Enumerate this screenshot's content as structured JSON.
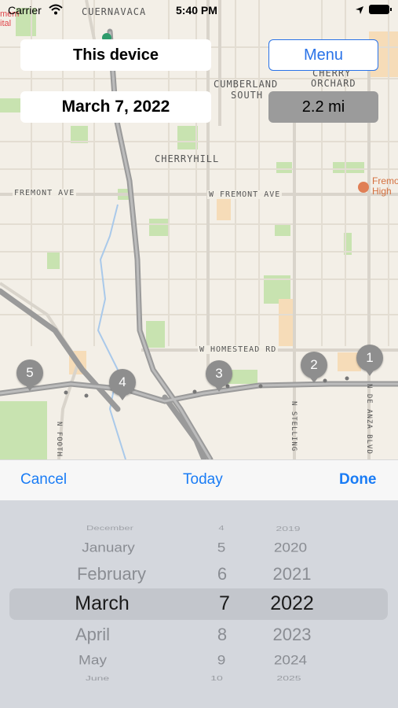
{
  "status_bar": {
    "carrier": "Carrier",
    "time": "5:40 PM"
  },
  "map": {
    "labels": {
      "cuernavaca": "CUERNAVACA",
      "cumberland_line1": "CUMBERLAND",
      "cumberland_line2": "SOUTH",
      "cherry_orchard_line1": "CHERRY",
      "cherry_orchard_line2": "ORCHARD",
      "cherryhill": "CHERRYHILL",
      "fremont_ave": "FREMONT AVE",
      "w_fremont_ave": "W FREMONT AVE",
      "w_homestead_rd": "W HOMESTEAD RD",
      "n_stelling": "N STELLING",
      "n_de_anza_blvd": "N DE ANZA BLVD",
      "n_foothill": "N FOOTH",
      "fremont_high_line1": "Fremo",
      "fremont_high_line2": "High",
      "hospital_line1": "mem",
      "hospital_line2": "ital"
    },
    "pins": [
      "1",
      "2",
      "3",
      "4",
      "5"
    ]
  },
  "overlay": {
    "device_label": "This device",
    "menu_label": "Menu",
    "date_label": "March 7, 2022",
    "distance_label": "2.2 mi"
  },
  "toolbar": {
    "cancel": "Cancel",
    "today": "Today",
    "done": "Done"
  },
  "picker": {
    "months": [
      "December",
      "January",
      "February",
      "March",
      "April",
      "May",
      "June"
    ],
    "days": [
      "4",
      "5",
      "6",
      "7",
      "8",
      "9",
      "10"
    ],
    "years": [
      "2019",
      "2020",
      "2021",
      "2022",
      "2023",
      "2024",
      "2025"
    ],
    "selected": {
      "month": "March",
      "day": "7",
      "year": "2022"
    }
  },
  "colors": {
    "accent": "#1a7cf5",
    "pin": "#8e8e8e",
    "highway": "#9a9a9a"
  }
}
